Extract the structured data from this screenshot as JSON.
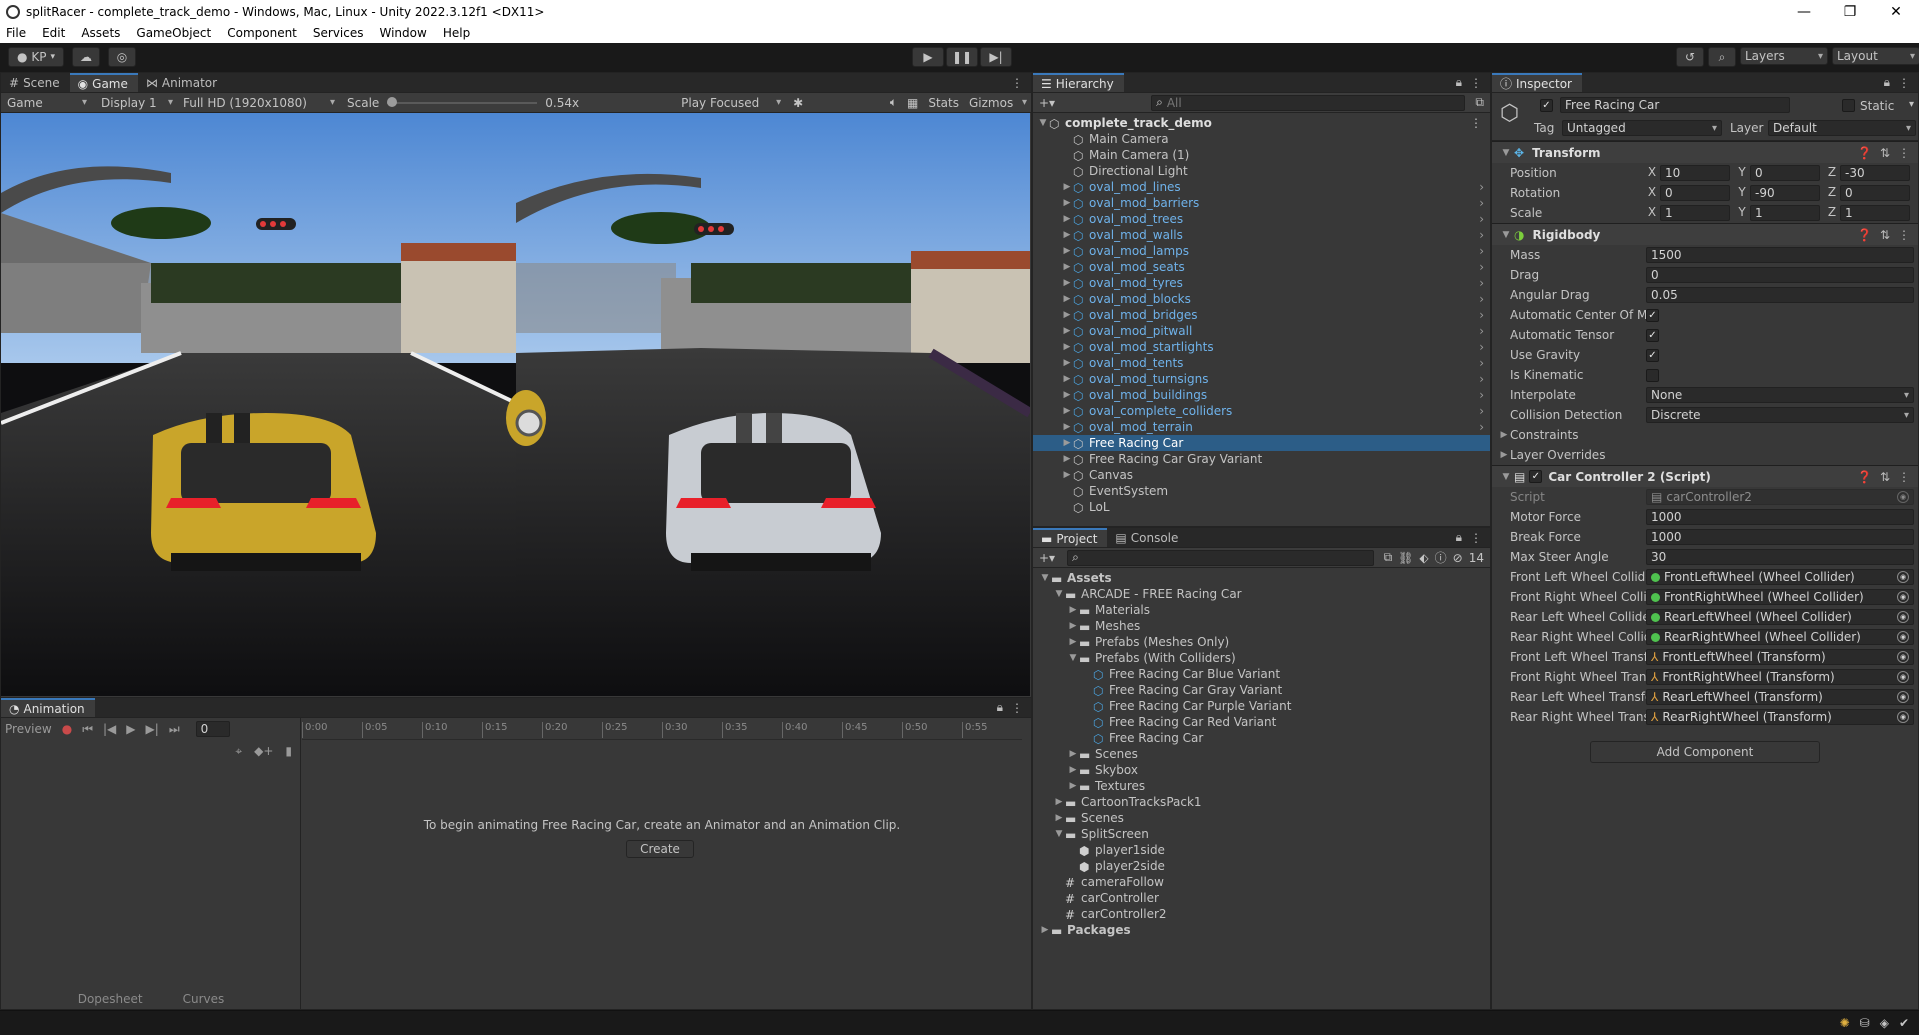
{
  "window": {
    "title": "splitRacer - complete_track_demo - Windows, Mac, Linux - Unity 2022.3.12f1 <DX11>"
  },
  "menu": [
    "File",
    "Edit",
    "Assets",
    "GameObject",
    "Component",
    "Services",
    "Window",
    "Help"
  ],
  "toolbar": {
    "account": "KP",
    "layers_label": "Layers",
    "layout_label": "Layout"
  },
  "scene_tabs": [
    "Scene",
    "Game",
    "Animator"
  ],
  "game_bar": {
    "mode": "Game",
    "display": "Display 1",
    "resolution": "Full HD (1920x1080)",
    "scale_label": "Scale",
    "scale_value": "0.54x",
    "scale_fraction": 0.0,
    "play_mode": "Play Focused",
    "stats": "Stats",
    "gizmos": "Gizmos"
  },
  "animation": {
    "tab": "Animation",
    "preview": "Preview",
    "frame": "0",
    "ticks": [
      "0:00",
      "0:05",
      "0:10",
      "0:15",
      "0:20",
      "0:25",
      "0:30",
      "0:35",
      "0:40",
      "0:45",
      "0:50",
      "0:55"
    ],
    "message": "To begin animating Free Racing Car, create an Animator and an Animation Clip.",
    "create_button": "Create",
    "dopesheet": "Dopesheet",
    "curves": "Curves"
  },
  "hierarchy": {
    "tab": "Hierarchy",
    "search_placeholder": "All",
    "scene": "complete_track_demo",
    "items": [
      {
        "label": "Main Camera",
        "prefab": false,
        "expandable": false,
        "selected": false
      },
      {
        "label": "Main Camera (1)",
        "prefab": false,
        "expandable": false,
        "selected": false
      },
      {
        "label": "Directional Light",
        "prefab": false,
        "expandable": false,
        "selected": false
      },
      {
        "label": "oval_mod_lines",
        "prefab": true,
        "expandable": true,
        "selected": false
      },
      {
        "label": "oval_mod_barriers",
        "prefab": true,
        "expandable": true,
        "selected": false
      },
      {
        "label": "oval_mod_trees",
        "prefab": true,
        "expandable": true,
        "selected": false
      },
      {
        "label": "oval_mod_walls",
        "prefab": true,
        "expandable": true,
        "selected": false
      },
      {
        "label": "oval_mod_lamps",
        "prefab": true,
        "expandable": true,
        "selected": false
      },
      {
        "label": "oval_mod_seats",
        "prefab": true,
        "expandable": true,
        "selected": false
      },
      {
        "label": "oval_mod_tyres",
        "prefab": true,
        "expandable": true,
        "selected": false
      },
      {
        "label": "oval_mod_blocks",
        "prefab": true,
        "expandable": true,
        "selected": false
      },
      {
        "label": "oval_mod_bridges",
        "prefab": true,
        "expandable": true,
        "selected": false
      },
      {
        "label": "oval_mod_pitwall",
        "prefab": true,
        "expandable": true,
        "selected": false
      },
      {
        "label": "oval_mod_startlights",
        "prefab": true,
        "expandable": true,
        "selected": false
      },
      {
        "label": "oval_mod_tents",
        "prefab": true,
        "expandable": true,
        "selected": false
      },
      {
        "label": "oval_mod_turnsigns",
        "prefab": true,
        "expandable": true,
        "selected": false
      },
      {
        "label": "oval_mod_buildings",
        "prefab": true,
        "expandable": true,
        "selected": false
      },
      {
        "label": "oval_complete_colliders",
        "prefab": true,
        "expandable": true,
        "selected": false
      },
      {
        "label": "oval_mod_terrain",
        "prefab": true,
        "expandable": true,
        "selected": false
      },
      {
        "label": "Free Racing Car",
        "prefab": false,
        "expandable": true,
        "selected": true
      },
      {
        "label": "Free Racing Car Gray Variant",
        "prefab": false,
        "expandable": true,
        "selected": false
      },
      {
        "label": "Canvas",
        "prefab": false,
        "expandable": true,
        "selected": false
      },
      {
        "label": "EventSystem",
        "prefab": false,
        "expandable": false,
        "selected": false
      },
      {
        "label": "LoL",
        "prefab": false,
        "expandable": false,
        "selected": false
      }
    ]
  },
  "project": {
    "tabs": [
      "Project",
      "Console"
    ],
    "hidden_count": "14",
    "tree": [
      {
        "label": "Assets",
        "depth": 0,
        "kind": "folder",
        "fold": "open",
        "bold": true
      },
      {
        "label": "ARCADE - FREE Racing Car",
        "depth": 1,
        "kind": "folder",
        "fold": "open",
        "bold": false
      },
      {
        "label": "Materials",
        "depth": 2,
        "kind": "folder",
        "fold": "closed",
        "bold": false
      },
      {
        "label": "Meshes",
        "depth": 2,
        "kind": "folder",
        "fold": "closed",
        "bold": false
      },
      {
        "label": "Prefabs (Meshes Only)",
        "depth": 2,
        "kind": "folder",
        "fold": "closed",
        "bold": false
      },
      {
        "label": "Prefabs (With Colliders)",
        "depth": 2,
        "kind": "folder",
        "fold": "open",
        "bold": false
      },
      {
        "label": "Free Racing Car Blue Variant",
        "depth": 3,
        "kind": "prefab",
        "fold": "none",
        "bold": false
      },
      {
        "label": "Free Racing Car Gray Variant",
        "depth": 3,
        "kind": "prefab",
        "fold": "none",
        "bold": false
      },
      {
        "label": "Free Racing Car Purple Variant",
        "depth": 3,
        "kind": "prefab",
        "fold": "none",
        "bold": false
      },
      {
        "label": "Free Racing Car Red Variant",
        "depth": 3,
        "kind": "prefab",
        "fold": "none",
        "bold": false
      },
      {
        "label": "Free Racing Car",
        "depth": 3,
        "kind": "prefab",
        "fold": "none",
        "bold": false
      },
      {
        "label": "Scenes",
        "depth": 2,
        "kind": "folder",
        "fold": "closed",
        "bold": false
      },
      {
        "label": "Skybox",
        "depth": 2,
        "kind": "folder",
        "fold": "closed",
        "bold": false
      },
      {
        "label": "Textures",
        "depth": 2,
        "kind": "folder",
        "fold": "closed",
        "bold": false
      },
      {
        "label": "CartoonTracksPack1",
        "depth": 1,
        "kind": "folder",
        "fold": "closed",
        "bold": false
      },
      {
        "label": "Scenes",
        "depth": 1,
        "kind": "folder",
        "fold": "closed",
        "bold": false
      },
      {
        "label": "SplitScreen",
        "depth": 1,
        "kind": "folder",
        "fold": "open",
        "bold": false
      },
      {
        "label": "player1side",
        "depth": 2,
        "kind": "scene",
        "fold": "none",
        "bold": false
      },
      {
        "label": "player2side",
        "depth": 2,
        "kind": "scene",
        "fold": "none",
        "bold": false
      },
      {
        "label": "cameraFollow",
        "depth": 1,
        "kind": "script",
        "fold": "none",
        "bold": false
      },
      {
        "label": "carController",
        "depth": 1,
        "kind": "script",
        "fold": "none",
        "bold": false
      },
      {
        "label": "carController2",
        "depth": 1,
        "kind": "script",
        "fold": "none",
        "bold": false
      },
      {
        "label": "Packages",
        "depth": 0,
        "kind": "folder",
        "fold": "closed",
        "bold": true
      }
    ]
  },
  "inspector": {
    "tab": "Inspector",
    "object_name": "Free Racing Car",
    "static_label": "Static",
    "tag_label": "Tag",
    "tag_value": "Untagged",
    "layer_label": "Layer",
    "layer_value": "Default",
    "transform": {
      "title": "Transform",
      "position_label": "Position",
      "position": [
        "10",
        "0",
        "-30"
      ],
      "rotation_label": "Rotation",
      "rotation": [
        "0",
        "-90",
        "0"
      ],
      "scale_label": "Scale",
      "scale": [
        "1",
        "1",
        "1"
      ],
      "axes": [
        "X",
        "Y",
        "Z"
      ]
    },
    "rigidbody": {
      "title": "Rigidbody",
      "mass_label": "Mass",
      "mass": "1500",
      "drag_label": "Drag",
      "drag": "0",
      "angular_drag_label": "Angular Drag",
      "angular_drag": "0.05",
      "auto_com_label": "Automatic Center Of Mass",
      "auto_com": true,
      "auto_tensor_label": "Automatic Tensor",
      "auto_tensor": true,
      "use_gravity_label": "Use Gravity",
      "use_gravity": true,
      "is_kinematic_label": "Is Kinematic",
      "is_kinematic": false,
      "interpolate_label": "Interpolate",
      "interpolate": "None",
      "collision_label": "Collision Detection",
      "collision": "Discrete",
      "constraints_label": "Constraints",
      "layer_overrides_label": "Layer Overrides"
    },
    "car_controller": {
      "title": "Car Controller 2 (Script)",
      "script_label": "Script",
      "script": "carController2",
      "motor_label": "Motor Force",
      "motor": "1000",
      "break_label": "Break Force",
      "break": "1000",
      "steer_label": "Max Steer Angle",
      "steer": "30",
      "wheels": [
        {
          "label": "Front Left Wheel Collider",
          "value": "FrontLeftWheel (Wheel Collider)",
          "kind": "collider"
        },
        {
          "label": "Front Right Wheel Collider",
          "value": "FrontRightWheel (Wheel Collider)",
          "kind": "collider"
        },
        {
          "label": "Rear Left Wheel Collider",
          "value": "RearLeftWheel (Wheel Collider)",
          "kind": "collider"
        },
        {
          "label": "Rear Right Wheel Collider",
          "value": "RearRightWheel (Wheel Collider)",
          "kind": "collider"
        },
        {
          "label": "Front Left Wheel Transform",
          "value": "FrontLeftWheel (Transform)",
          "kind": "transform"
        },
        {
          "label": "Front Right Wheel Transform",
          "value": "FrontRightWheel (Transform)",
          "kind": "transform"
        },
        {
          "label": "Rear Left Wheel Transform",
          "value": "RearLeftWheel (Transform)",
          "kind": "transform"
        },
        {
          "label": "Rear Right Wheel Transform",
          "value": "RearRightWheel (Transform)",
          "kind": "transform"
        }
      ]
    },
    "add_component": "Add Component"
  }
}
